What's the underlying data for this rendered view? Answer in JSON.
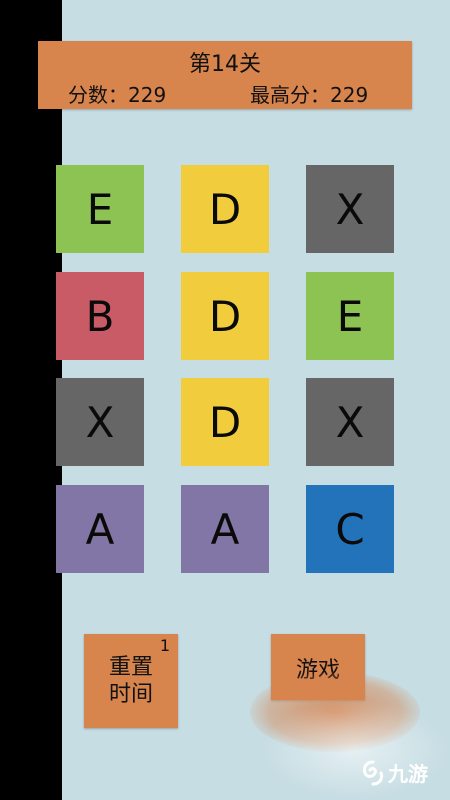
{
  "header": {
    "level_title": "第14关",
    "score_text": "分数：229",
    "best_score_text": "最高分：229"
  },
  "tiles": [
    {
      "letter": "E",
      "color": "#8dc353"
    },
    {
      "letter": "D",
      "color": "#f1cd3e"
    },
    {
      "letter": "X",
      "color": "#666666"
    },
    {
      "letter": "B",
      "color": "#c95b66"
    },
    {
      "letter": "D",
      "color": "#f1cd3e"
    },
    {
      "letter": "E",
      "color": "#8dc353"
    },
    {
      "letter": "X",
      "color": "#666666"
    },
    {
      "letter": "D",
      "color": "#f1cd3e"
    },
    {
      "letter": "X",
      "color": "#666666"
    },
    {
      "letter": "A",
      "color": "#8276a6"
    },
    {
      "letter": "A",
      "color": "#8276a6"
    },
    {
      "letter": "C",
      "color": "#2373bb"
    }
  ],
  "buttons": {
    "reset_time_label_line1": "重置",
    "reset_time_label_line2": "时间",
    "reset_time_count": "1",
    "game_label": "游戏"
  },
  "watermark": {
    "text": "九游",
    "icon": "jiuyou-logo-icon"
  }
}
